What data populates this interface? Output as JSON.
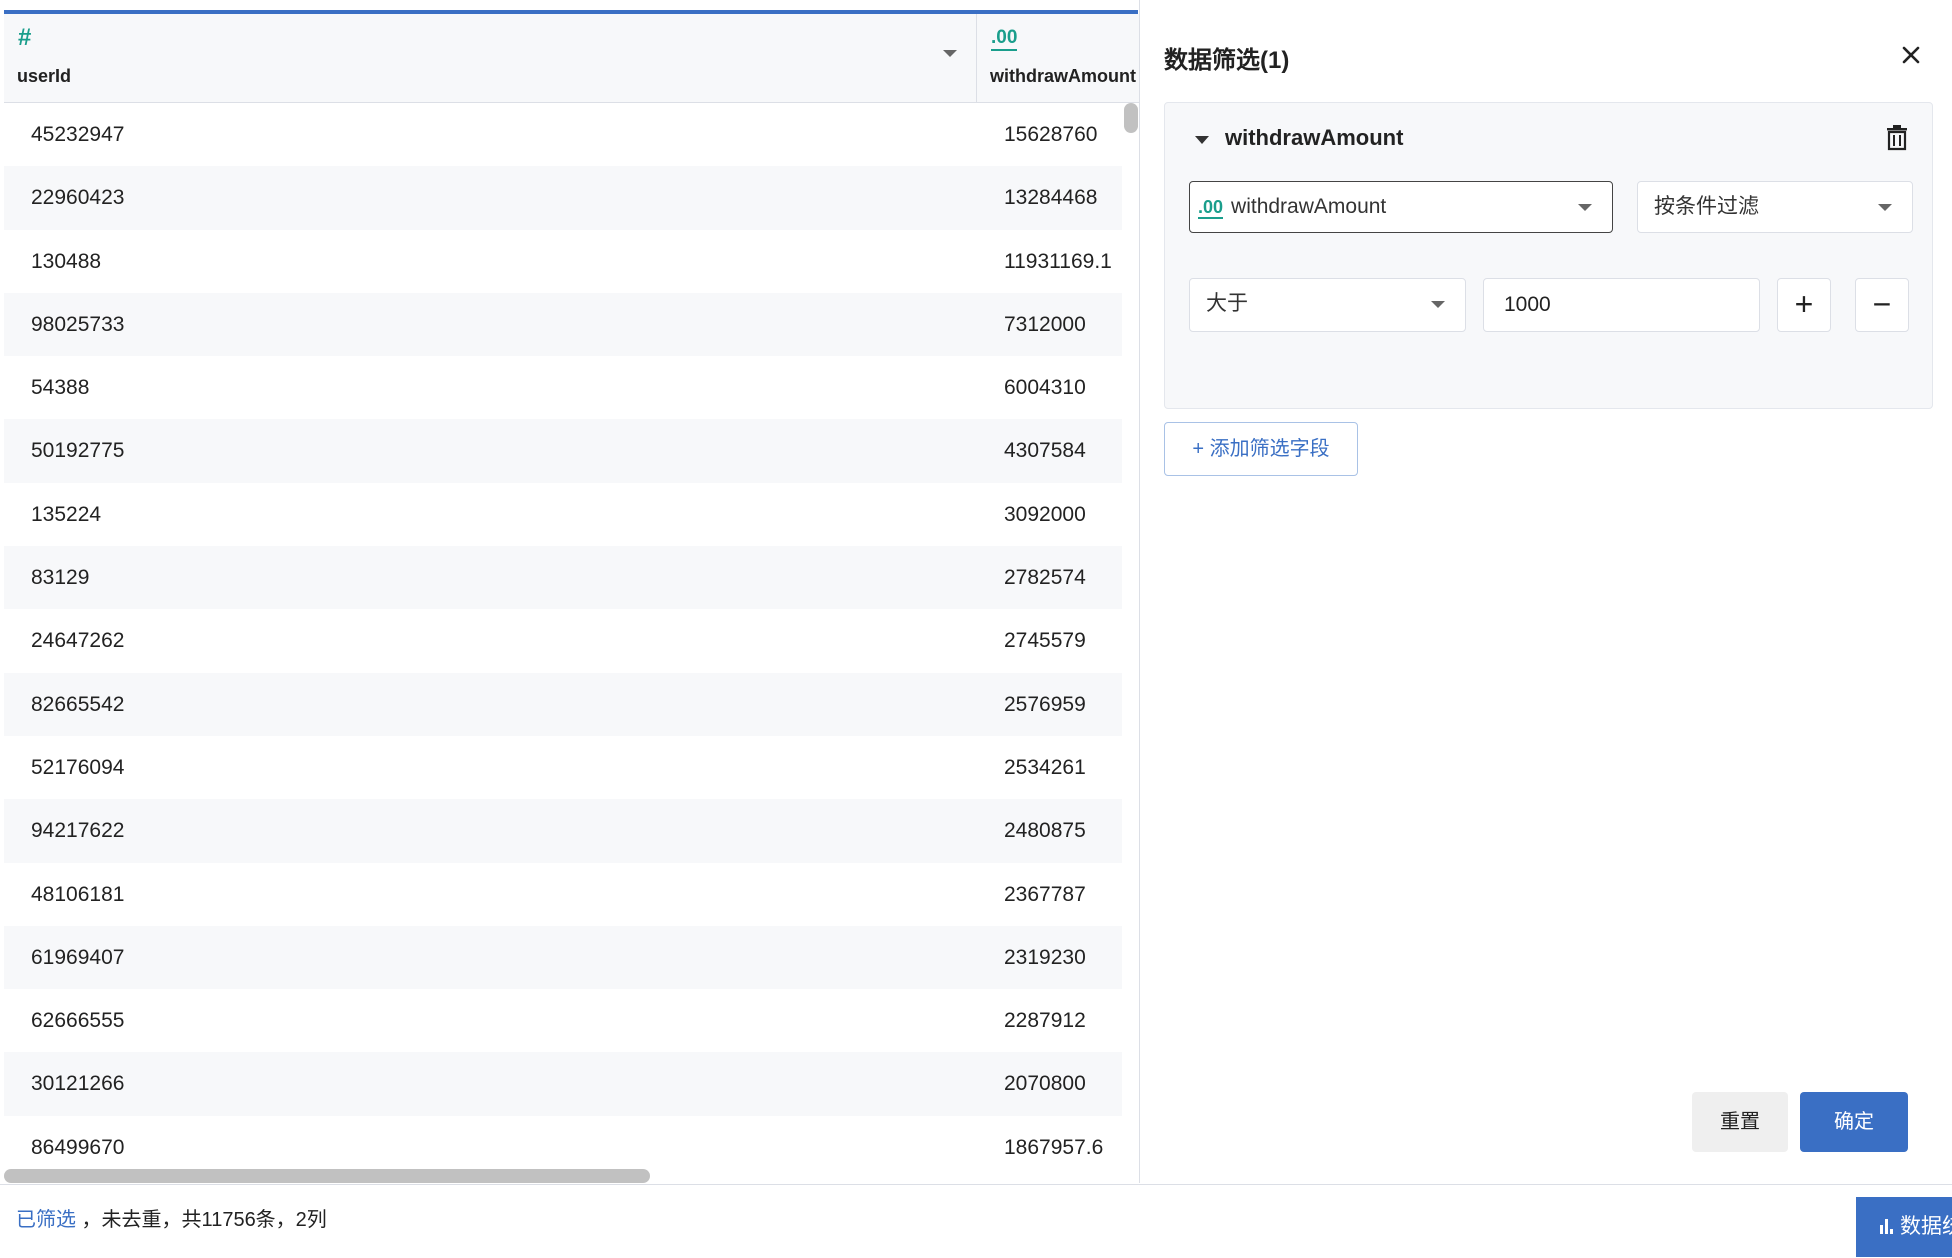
{
  "table": {
    "columns": [
      {
        "type_icon": "#",
        "name": "userId"
      },
      {
        "type_icon": ".00",
        "name": "withdrawAmount"
      }
    ],
    "rows": [
      {
        "userId": "45232947",
        "withdrawAmount": "15628760"
      },
      {
        "userId": "22960423",
        "withdrawAmount": "13284468"
      },
      {
        "userId": "130488",
        "withdrawAmount": "11931169.1"
      },
      {
        "userId": "98025733",
        "withdrawAmount": "7312000"
      },
      {
        "userId": "54388",
        "withdrawAmount": "6004310"
      },
      {
        "userId": "50192775",
        "withdrawAmount": "4307584"
      },
      {
        "userId": "135224",
        "withdrawAmount": "3092000"
      },
      {
        "userId": "83129",
        "withdrawAmount": "2782574"
      },
      {
        "userId": "24647262",
        "withdrawAmount": "2745579"
      },
      {
        "userId": "82665542",
        "withdrawAmount": "2576959"
      },
      {
        "userId": "52176094",
        "withdrawAmount": "2534261"
      },
      {
        "userId": "94217622",
        "withdrawAmount": "2480875"
      },
      {
        "userId": "48106181",
        "withdrawAmount": "2367787"
      },
      {
        "userId": "61969407",
        "withdrawAmount": "2319230"
      },
      {
        "userId": "62666555",
        "withdrawAmount": "2287912"
      },
      {
        "userId": "30121266",
        "withdrawAmount": "2070800"
      },
      {
        "userId": "86499670",
        "withdrawAmount": "1867957.6"
      }
    ]
  },
  "filter_panel": {
    "title": "数据筛选(1)",
    "card": {
      "field_name": "withdrawAmount",
      "field_select": {
        "type_icon": ".00",
        "value": "withdrawAmount"
      },
      "mode_select": "按条件过滤",
      "operator_select": "大于",
      "value_input": "1000",
      "plus_label": "+",
      "minus_label": "−"
    },
    "add_field_label": "+ 添加筛选字段",
    "reset_label": "重置",
    "confirm_label": "确定"
  },
  "footer": {
    "filtered_link": "已筛选",
    "status_text": " ，未去重，共11756条，2列",
    "data_button_label": "数据统"
  },
  "colors": {
    "accent": "#3a6fc4",
    "type_icon": "#1a9e8c"
  }
}
